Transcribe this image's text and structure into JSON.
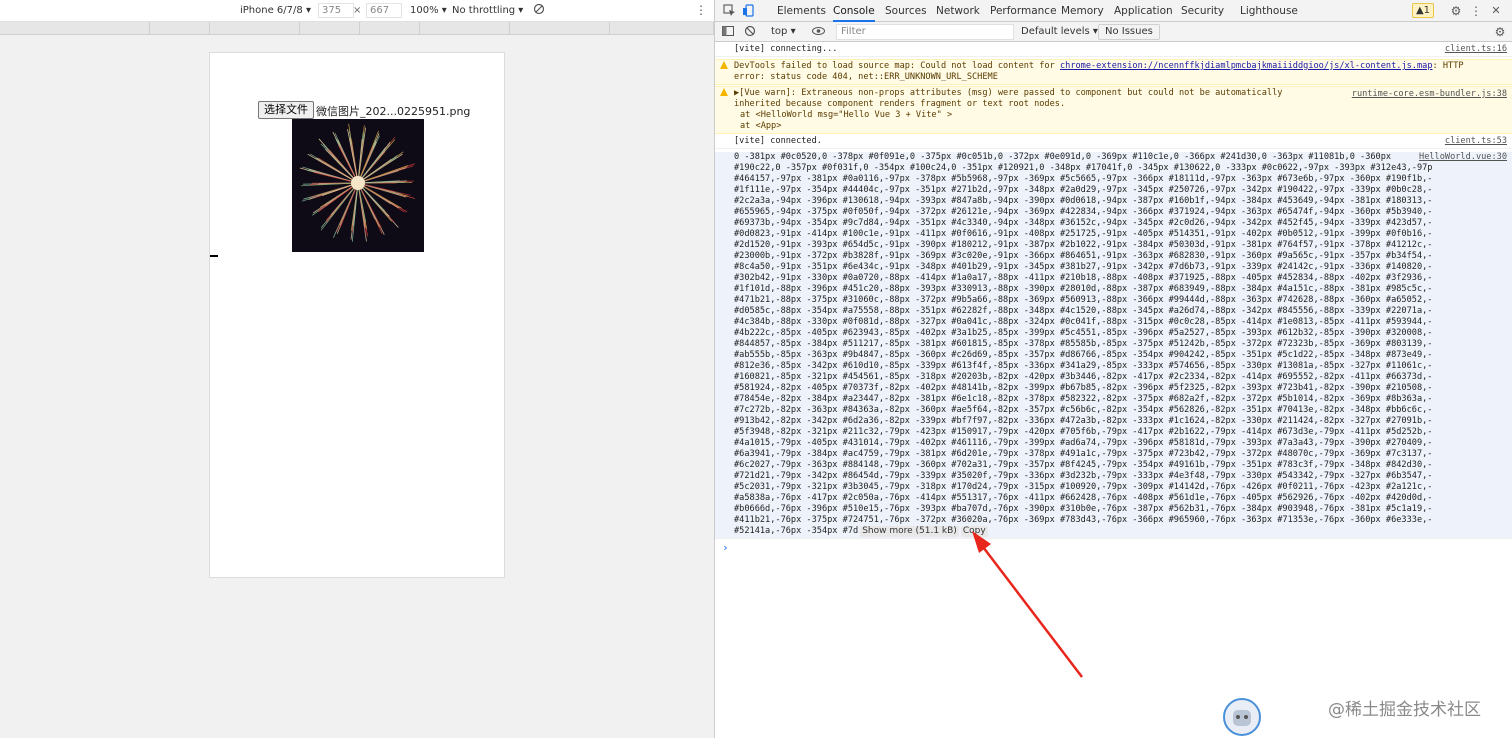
{
  "device_toolbar": {
    "device": "iPhone 6/7/8 ▾",
    "width": "375",
    "times": "×",
    "height": "667",
    "zoom": "100% ▾",
    "throttle": "No throttling ▾"
  },
  "page": {
    "file_button": "选择文件",
    "file_name": "微信图片_202...0225951.png"
  },
  "devtools": {
    "tabs": [
      "Elements",
      "Console",
      "Sources",
      "Network",
      "Performance",
      "Memory",
      "Application",
      "Security",
      "Lighthouse"
    ],
    "active_tab": "Console",
    "warn_count": "▲1",
    "context": "top ▾",
    "filter_placeholder": "Filter",
    "levels": "Default levels ▾",
    "issues": "No Issues"
  },
  "console": {
    "msg1": {
      "text": "[vite] connecting...",
      "src": "client.ts:16"
    },
    "msg2": {
      "pre": "DevTools failed to load source map: Could not load content for ",
      "link": "chrome-extension://ncennffkjdiamlpmcbajkmaiiiddgioo/js/xl-content.js.map",
      "post": ": HTTP",
      "line2": "error: status code 404, net::ERR_UNKNOWN_URL_SCHEME"
    },
    "msg3": {
      "line1": "▶[Vue warn]: Extraneous non-props attributes (msg) were passed to component but could not be automatically",
      "line2": "inherited because component renders fragment or text root nodes.",
      "line3": "  at <HelloWorld msg=\"Hello Vue 3 + Vite\" >",
      "line4": "  at <App>",
      "src": "runtime-core.esm-bundler.js:38"
    },
    "msg4": {
      "text": "[vite] connected.",
      "src": "client.ts:53"
    },
    "dump_src": "HelloWorld.vue:30",
    "dump": [
      "0 -381px #0c0520,0 -378px #0f091e,0 -375px #0c051b,0 -372px #0e091d,0 -369px #110c1e,0 -366px #241d30,0 -363px #11081b,0 -360px",
      "#190c22,0 -357px #0f031f,0 -354px #100c24,0 -351px #120921,0 -348px #17041f,0 -345px #130622,0 -333px #0c0622,-97px -393px #312e43,-97px -384px",
      "#464157,-97px -381px #0a0116,-97px -378px #5b5968,-97px -369px #5c5665,-97px -366px #18111d,-97px -363px #673e6b,-97px -360px #190f1b,-97px -357px",
      "#1f111e,-97px -354px #44404c,-97px -351px #271b2d,-97px -348px #2a0d29,-97px -345px #250726,-97px -342px #190422,-97px -339px #0b0c28,-94px -405px",
      "#2c2a3a,-94px -396px #130618,-94px -393px #847a8b,-94px -390px #0d0618,-94px -387px #160b1f,-94px -384px #453649,-94px -381px #180313,-94px -378px",
      "#655965,-94px -375px #0f050f,-94px -372px #26121e,-94px -369px #422834,-94px -366px #371924,-94px -363px #65474f,-94px -360px #5b3940,-94px -357px",
      "#69373b,-94px -354px #9c7d84,-94px -351px #4c3340,-94px -348px #36152c,-94px -345px #2c0d26,-94px -342px #452f45,-94px -339px #423d57,-91px -336px",
      "#0d0823,-91px -414px #100c1e,-91px -411px #0f0616,-91px -408px #251725,-91px -405px #514351,-91px -402px #0b0512,-91px -399px #0f0b16,-91px -396px",
      "#2d1520,-91px -393px #654d5c,-91px -390px #180212,-91px -387px #2b1022,-91px -384px #50303d,-91px -381px #764f57,-91px -378px #41212c,-91px -375px",
      "#23000b,-91px -372px #b3828f,-91px -369px #3c020e,-91px -366px #864651,-91px -363px #682830,-91px -360px #9a565c,-91px -357px #b34f54,-91px -354px",
      "#8c4a50,-91px -351px #6e434c,-91px -348px #401b29,-91px -345px #381b27,-91px -342px #7d6b73,-91px -339px #24142c,-91px -336px #140820,-91px -333px",
      "#302b42,-91px -330px #0a0720,-88px -414px #1a0a17,-88px -411px #210b18,-88px -408px #371925,-88px -405px #452834,-88px -402px #3f2936,-88px -399px",
      "#1f101d,-88px -396px #451c20,-88px -393px #330913,-88px -390px #28010d,-88px -387px #683949,-88px -384px #4a151c,-88px -381px #985c5c,-88px -378px",
      "#471b21,-88px -375px #31060c,-88px -372px #9b5a66,-88px -369px #560913,-88px -366px #99444d,-88px -363px #742628,-88px -360px #a65052,-88px -357px",
      "#d0585c,-88px -354px #a75558,-88px -351px #62282f,-88px -348px #4c1520,-88px -345px #a26d74,-88px -342px #845556,-88px -339px #22071a,-88px -336px",
      "#4c384b,-88px -330px #0f081d,-88px -327px #0a041c,-88px -324px #0c041f,-88px -315px #0c0c28,-85px -414px #1e0813,-85px -411px #593944,-85px -408px",
      "#4b222c,-85px -405px #623943,-85px -402px #3a1b25,-85px -399px #5c4551,-85px -396px #5a2527,-85px -393px #612b32,-85px -390px #320008,-85px -387px",
      "#844857,-85px -384px #511217,-85px -381px #601815,-85px -378px #85585b,-85px -375px #51242b,-85px -372px #72323b,-85px -369px #803139,-85px -366px",
      "#ab555b,-85px -363px #9b4847,-85px -360px #c26d69,-85px -357px #d86766,-85px -354px #904242,-85px -351px #5c1d22,-85px -348px #873e49,-85px -345px",
      "#812e36,-85px -342px #610d10,-85px -339px #613f4f,-85px -336px #341a29,-85px -333px #574656,-85px -330px #13081a,-85px -327px #11061c,-85px -324px",
      "#160821,-85px -321px #454561,-85px -318px #20203b,-82px -420px #3b3446,-82px -417px #2c2334,-82px -414px #695552,-82px -411px #66373d,-82px -408px",
      "#581924,-82px -405px #70373f,-82px -402px #48141b,-82px -399px #b67b85,-82px -396px #5f2325,-82px -393px #723b41,-82px -390px #210508,-82px -387px",
      "#78454e,-82px -384px #a23447,-82px -381px #6e1c18,-82px -378px #582322,-82px -375px #682a2f,-82px -372px #5b1014,-82px -369px #8b363a,-82px -366px",
      "#7c272b,-82px -363px #84363a,-82px -360px #ae5f64,-82px -357px #c56b6c,-82px -354px #562826,-82px -351px #70413e,-82px -348px #bb6c6c,-82px -345px",
      "#913b42,-82px -342px #6d2a36,-82px -339px #bf7f97,-82px -336px #472a3b,-82px -333px #1c1624,-82px -330px #211424,-82px -327px #27091b,-82px -324px",
      "#5f3948,-82px -321px #211c32,-79px -423px #150917,-79px -420px #705f6b,-79px -417px #2b1622,-79px -414px #673d3e,-79px -411px #5d252b,-79px -408px",
      "#4a1015,-79px -405px #431014,-79px -402px #461116,-79px -399px #ad6a74,-79px -396px #58181d,-79px -393px #7a3a43,-79px -390px #270409,-79px -387px",
      "#6a3941,-79px -384px #ac4759,-79px -381px #6d201e,-79px -378px #491a1c,-79px -375px #723b42,-79px -372px #48070c,-79px -369px #7c3137,-79px -366px",
      "#6c2027,-79px -363px #884148,-79px -360px #702a31,-79px -357px #8f4245,-79px -354px #49161b,-79px -351px #783c3f,-79px -348px #842d30,-79px -345px",
      "#721d21,-79px -342px #86454d,-79px -339px #35020f,-79px -336px #3d232b,-79px -333px #4e3f48,-79px -330px #543342,-79px -327px #6b3547,-79px -324px",
      "#5c2031,-79px -321px #3b3045,-79px -318px #170d24,-79px -315px #100920,-79px -309px #14142d,-76px -426px #0f0211,-76px -423px #2a121c,-76px -420px",
      "#a5838a,-76px -417px #2c050a,-76px -414px #551317,-76px -411px #662428,-76px -408px #561d1e,-76px -405px #562926,-76px -402px #420d0d,-76px -399px",
      "#b0666d,-76px -396px #510e15,-76px -393px #ba707d,-76px -390px #310b0e,-76px -387px #562b31,-76px -384px #903948,-76px -381px #5c1a19,-76px -378px",
      "#411b21,-76px -375px #724751,-76px -372px #36020a,-76px -369px #783d43,-76px -366px #965960,-76px -363px #71353e,-76px -360px #6e333e,-76px -357px"
    ],
    "dump_last": "#52141a,-76px -354px #7d",
    "show_more": "Show more (51.1 kB)",
    "copy": "Copy"
  },
  "watermark": "@稀土掘金技术社区",
  "colors": {
    "accent": "#1a73e8",
    "warn_bg": "#fffbe5",
    "arrow": "#e8261c"
  }
}
